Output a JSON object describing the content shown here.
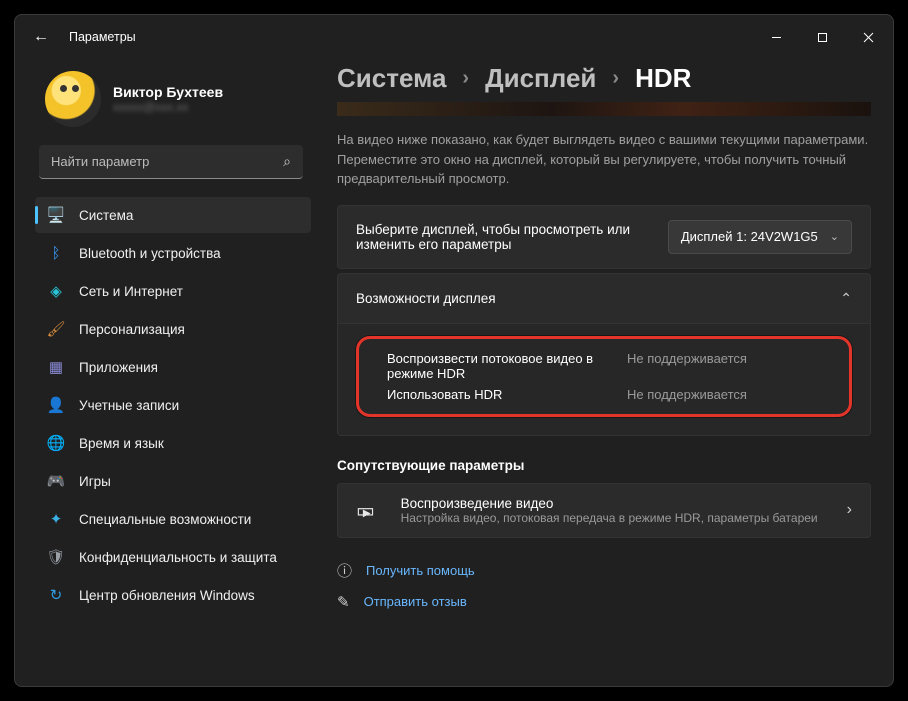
{
  "titlebar": {
    "title": "Параметры"
  },
  "profile": {
    "name": "Виктор Бухтеев",
    "email": "xxxxx@xxx.xx"
  },
  "search": {
    "placeholder": "Найти параметр"
  },
  "sidebar": {
    "items": [
      {
        "label": "Система",
        "icon": "🖥️",
        "color": "#4cc2ff",
        "active": true
      },
      {
        "label": "Bluetooth и устройства",
        "icon": "ᛒ",
        "color": "#3b9dff"
      },
      {
        "label": "Сеть и Интернет",
        "icon": "◈",
        "color": "#28c1d6"
      },
      {
        "label": "Персонализация",
        "icon": "🖌",
        "color": "#d68b3c"
      },
      {
        "label": "Приложения",
        "icon": "▦",
        "color": "#8a8ad6"
      },
      {
        "label": "Учетные записи",
        "icon": "👤",
        "color": "#7fa7c9"
      },
      {
        "label": "Время и язык",
        "icon": "🌐",
        "color": "#3b9dff"
      },
      {
        "label": "Игры",
        "icon": "🎮",
        "color": "#a8a8a8"
      },
      {
        "label": "Специальные возможности",
        "icon": "✦",
        "color": "#3bb1e6"
      },
      {
        "label": "Конфиденциальность и защита",
        "icon": "🛡",
        "color": "#9aa0a6"
      },
      {
        "label": "Центр обновления Windows",
        "icon": "↻",
        "color": "#2f9de0"
      }
    ]
  },
  "breadcrumb": {
    "a": "Система",
    "b": "Дисплей",
    "c": "HDR"
  },
  "description": "На видео ниже показано, как будет выглядеть видео с вашими текущими параметрами. Переместите это окно на дисплей, который вы регулируете, чтобы получить точный предварительный просмотр.",
  "display_select": {
    "prompt": "Выберите дисплей, чтобы просмотреть или изменить его параметры",
    "value": "Дисплей 1: 24V2W1G5"
  },
  "capabilities": {
    "header": "Возможности дисплея",
    "row1_label": "Воспроизвести потоковое видео в режиме HDR",
    "row1_value": "Не поддерживается",
    "row2_label": "Использовать HDR",
    "row2_value": "Не поддерживается"
  },
  "related": {
    "title": "Сопутствующие параметры",
    "card_title": "Воспроизведение видео",
    "card_sub": "Настройка видео, потоковая передача в режиме HDR, параметры батареи"
  },
  "footer": {
    "help": "Получить помощь",
    "feedback": "Отправить отзыв"
  }
}
